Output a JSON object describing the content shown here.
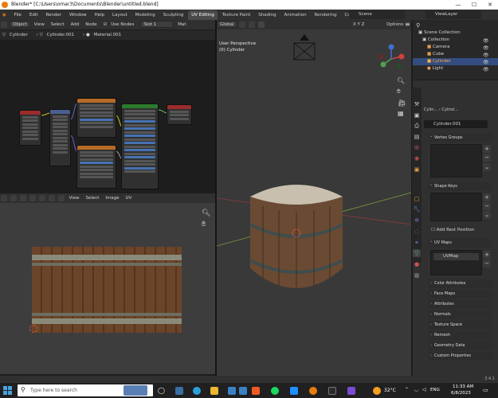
{
  "window": {
    "title": "Blender* [C:\\Users\\omar3\\Documents\\Blender\\untitled.blend]"
  },
  "menubar": {
    "menus": [
      "File",
      "Edit",
      "Render",
      "Window",
      "Help"
    ],
    "workspaces": [
      "Layout",
      "Modeling",
      "Sculpting",
      "UV Editing",
      "Texture Paint",
      "Shading",
      "Animation",
      "Rendering",
      "Compositing"
    ],
    "scene": "Scene",
    "view_layer": "ViewLayer"
  },
  "node_editor": {
    "mode": "Object",
    "menus": [
      "View",
      "Select",
      "Add",
      "Node"
    ],
    "use_nodes": "Use Nodes",
    "slot": "Slot 1",
    "mat_short": "Mat",
    "breadcrumb": [
      "Cylinder",
      "Cylinder.001",
      "Material.001"
    ]
  },
  "uv_editor": {
    "menus": [
      "View",
      "Select",
      "Image",
      "UV"
    ]
  },
  "viewport": {
    "orientation": "Global",
    "options": "Options",
    "perspective": "User Perspective",
    "object": "(0) Cylinder"
  },
  "outliner": {
    "items": [
      {
        "label": "Scene Collection"
      },
      {
        "label": "Collection"
      },
      {
        "label": "Camera"
      },
      {
        "label": "Cube"
      },
      {
        "label": "Cylinder"
      },
      {
        "label": "Light"
      }
    ]
  },
  "properties": {
    "breadcrumb_a": "Cylin...",
    "breadcrumb_b": "Cylind...",
    "data_name": "Cylinder.001",
    "vertex_groups": "Vertex Groups",
    "shape_keys": "Shape Keys",
    "add_rest_position": "Add Rest Position",
    "uv_maps": "UV Maps",
    "uv_map_name": "UVMap",
    "collapsed": [
      "Color Attributes",
      "Face Maps",
      "Attributes",
      "Normals",
      "Texture Space",
      "Remesh",
      "Geometry Data",
      "Custom Properties"
    ]
  },
  "status": {
    "version": "3.4.1"
  },
  "taskbar": {
    "search_placeholder": "Type here to search",
    "weather": "32°C",
    "lang": "ENG",
    "time": "11:33 AM",
    "date": "6/8/2023"
  }
}
